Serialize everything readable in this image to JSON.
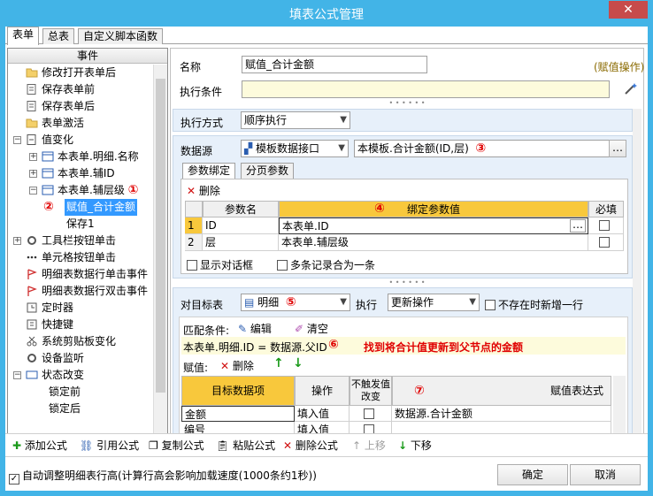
{
  "window": {
    "title": "填表公式管理",
    "close": "✕"
  },
  "tabs": [
    "表单",
    "总表",
    "自定义脚本函数"
  ],
  "left": {
    "header": "事件",
    "nodes": [
      {
        "label": "修改打开表单后"
      },
      {
        "label": "保存表单前"
      },
      {
        "label": "保存表单后"
      },
      {
        "label": "表单激活"
      },
      {
        "label": "值变化"
      },
      {
        "label": "本表单.明细.名称"
      },
      {
        "label": "本表单.辅ID"
      },
      {
        "label": "本表单.辅层级"
      },
      {
        "label": "赋值_合计金额"
      },
      {
        "label": "保存1"
      },
      {
        "label": "工具栏按钮单击"
      },
      {
        "label": "单元格按钮单击"
      },
      {
        "label": "明细表数据行单击事件"
      },
      {
        "label": "明细表数据行双击事件"
      },
      {
        "label": "定时器"
      },
      {
        "label": "快捷键"
      },
      {
        "label": "系统剪贴板变化"
      },
      {
        "label": "设备监听"
      },
      {
        "label": "状态改变"
      },
      {
        "label": "锁定前"
      },
      {
        "label": "锁定后"
      }
    ],
    "marker1": "①",
    "marker2": "②"
  },
  "main": {
    "name_label": "名称",
    "name_value": "赋值_合计金额",
    "assign_op": "(赋值操作)",
    "cond_label": "执行条件",
    "exec_mode_label": "执行方式",
    "exec_mode_value": "顺序执行",
    "datasource_label": "数据源",
    "datasource_value": "模板数据接口",
    "datasource_expr": "本模板.合计金额(ID,层)",
    "marker3": "③",
    "subtabs": [
      "参数绑定",
      "分页参数"
    ],
    "delete_label": "删除",
    "param_headers": [
      "参数名",
      "绑定参数值",
      "必填"
    ],
    "marker4": "④",
    "params": [
      {
        "num": "1",
        "name": "ID",
        "value": "本表单.ID"
      },
      {
        "num": "2",
        "name": "层",
        "value": "本表单.辅层级"
      }
    ],
    "show_dialog": "显示对话框",
    "merge_rows": "多条记录合为一条",
    "target_label": "对目标表",
    "target_value": "明细",
    "marker5": "⑤",
    "exec_label": "执行",
    "exec_value": "更新操作",
    "insert_label": "不存在时新增一行",
    "match_label": "匹配条件:",
    "edit_label": "编辑",
    "clear_label": "清空",
    "match_expr": "本表单.明细.ID = 数据源.父ID",
    "marker6": "⑥",
    "annotation": "找到将合计值更新到父节点的金额",
    "assign_label": "赋值:",
    "assign_delete": "删除",
    "assign_headers": [
      "目标数据项",
      "操作",
      "不触发值改变",
      "赋值表达式"
    ],
    "marker7": "⑦",
    "assign_rows": [
      {
        "target": "金额",
        "op": "填入值",
        "expr": "数据源.合计金额"
      },
      {
        "target": "编号",
        "op": "填入值",
        "expr": ""
      }
    ]
  },
  "toolbar": {
    "add": "添加公式",
    "ref": "引用公式",
    "copy": "复制公式",
    "paste": "粘贴公式",
    "del": "删除公式",
    "up": "上移",
    "down": "下移"
  },
  "footer": {
    "auto_adjust": "自动调整明细表行高(计算行高会影响加载速度(1000条约1秒))",
    "ok": "确定",
    "cancel": "取消"
  }
}
